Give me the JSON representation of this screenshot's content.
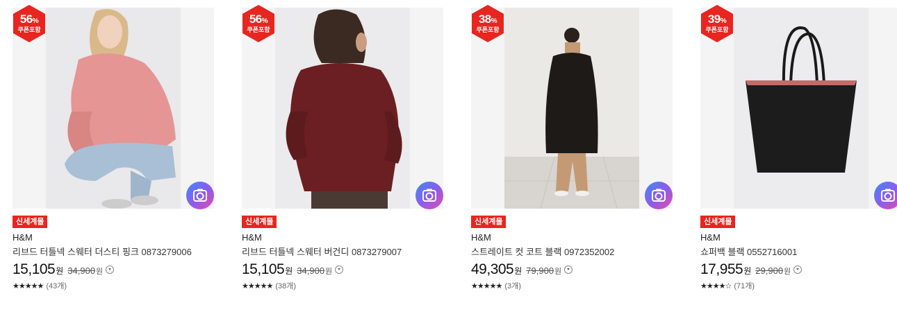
{
  "products": [
    {
      "discount": "56",
      "discount_unit": "%",
      "discount_note": "쿠폰포함",
      "tag": "신세계몰",
      "brand": "H&M",
      "name": "리브드 터틀넥 스웨터 더스티 핑크 0873279006",
      "price": "15,105",
      "price_unit": "원",
      "original_price": "34,900",
      "original_unit": "원",
      "stars": "★★★★★",
      "review_count": "(43개)"
    },
    {
      "discount": "56",
      "discount_unit": "%",
      "discount_note": "쿠폰포함",
      "tag": "신세계몰",
      "brand": "H&M",
      "name": "리브드 터틀넥 스웨터 버건디 0873279007",
      "price": "15,105",
      "price_unit": "원",
      "original_price": "34,900",
      "original_unit": "원",
      "stars": "★★★★★",
      "review_count": "(38개)"
    },
    {
      "discount": "38",
      "discount_unit": "%",
      "discount_note": "쿠폰포함",
      "tag": "신세계몰",
      "brand": "H&M",
      "name": "스트레이트 컷 코트 블랙 0972352002",
      "price": "49,305",
      "price_unit": "원",
      "original_price": "79,900",
      "original_unit": "원",
      "stars": "★★★★★",
      "review_count": "(3개)"
    },
    {
      "discount": "39",
      "discount_unit": "%",
      "discount_note": "쿠폰포함",
      "tag": "신세계몰",
      "brand": "H&M",
      "name": "쇼퍼백 블랙 0552716001",
      "price": "17,955",
      "price_unit": "원",
      "original_price": "29,900",
      "original_unit": "원",
      "stars": "★★★★☆",
      "review_count": "(71개)"
    }
  ],
  "colors": {
    "badge_red": "#e8251f",
    "tag_red": "#e8251f"
  },
  "icons": [
    "camera-search-icon",
    "info-dropdown-icon"
  ]
}
